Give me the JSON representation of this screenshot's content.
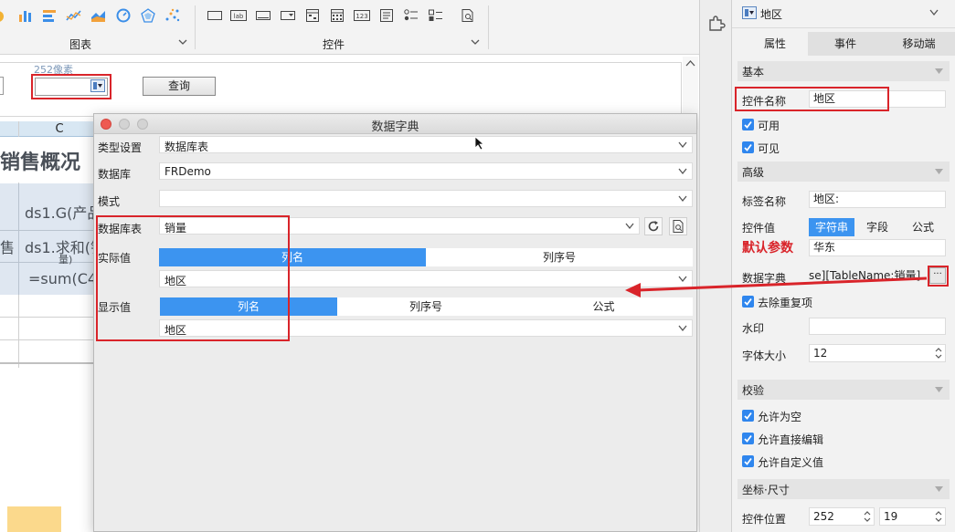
{
  "toolbar": {
    "chart_group_label": "图表",
    "control_group_label": "控件",
    "chart_icons": [
      "pie-chart-icon",
      "bar-chart-icon",
      "horizontal-bar-icon",
      "line-chart-icon",
      "area-chart-icon",
      "gauge-icon",
      "radar-icon",
      "scatter-icon"
    ],
    "control_icons": [
      "label-icon",
      "lab-icon",
      "button-icon",
      "dropdown-icon",
      "date-icon",
      "calendar-icon",
      "number-icon",
      "list-icon",
      "radio-group-icon",
      "checkbox-group-icon",
      "tree-icon"
    ],
    "control_lab_text": "lab",
    "control_num_text": "123"
  },
  "canvas": {
    "pixel_label": "252像素",
    "query_button": "查询",
    "col_header": "C",
    "title_cell": "销售概况",
    "cells": {
      "r1": "ds1.G(产品",
      "r2_left": "售",
      "r2": "ds1.求和(销",
      "r2_wrap": "量)",
      "r3": "=sum(C4"
    }
  },
  "dialog": {
    "title": "数据字典",
    "type_label": "类型设置",
    "type_value": "数据库表",
    "db_label": "数据库",
    "db_value": "FRDemo",
    "schema_label": "模式",
    "schema_value": "",
    "table_label": "数据库表",
    "table_value": "销量",
    "actual_label": "实际值",
    "actual_tabs": [
      "列名",
      "列序号"
    ],
    "actual_value": "地区",
    "display_label": "显示值",
    "display_tabs": [
      "列名",
      "列序号",
      "公式"
    ],
    "display_value": "地区"
  },
  "props": {
    "widget_type": "地区",
    "tabs": [
      "属性",
      "事件",
      "移动端"
    ],
    "section_basic": "基本",
    "name_label": "控件名称",
    "name_value": "地区",
    "enabled_label": "可用",
    "visible_label": "可见",
    "section_advanced": "高级",
    "tag_label": "标签名称",
    "tag_value": "地区:",
    "value_label": "控件值",
    "value_tabs": [
      "字符串",
      "字段",
      "公式"
    ],
    "default_param_label": "默认参数",
    "default_value": "华东",
    "dict_label": "数据字典",
    "dict_value": "se][TableName:销量]",
    "dict_button": "···",
    "remove_dup_label": "去除重复项",
    "watermark_label": "水印",
    "watermark_value": "",
    "font_size_label": "字体大小",
    "font_size_value": "12",
    "section_validate": "校验",
    "allow_empty": "允许为空",
    "allow_edit": "允许直接编辑",
    "allow_custom": "允许自定义值",
    "section_position": "坐标·尺寸",
    "position_label": "控件位置",
    "pos_x": "252",
    "pos_y": "19"
  },
  "colors": {
    "accent_blue": "#3c94f0",
    "highlight_red": "#d9242a",
    "checkbox_blue": "#2f86ee"
  }
}
